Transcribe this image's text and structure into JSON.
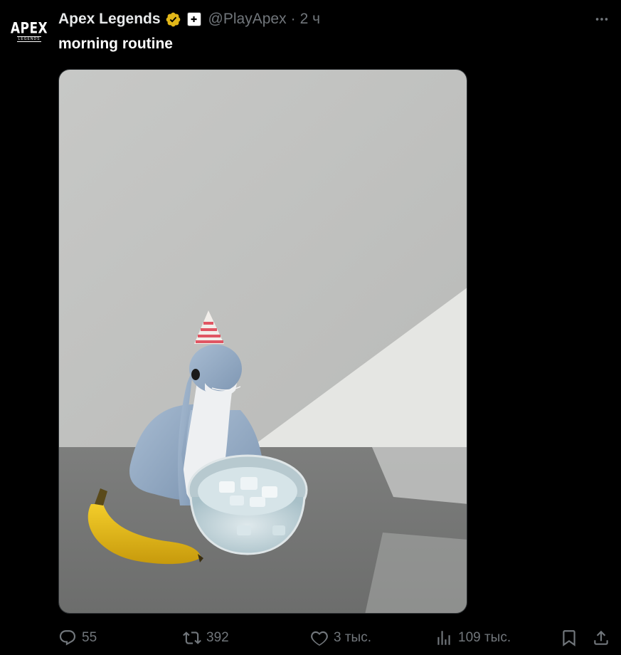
{
  "author": {
    "name": "Apex Legends",
    "handle": "@PlayApex",
    "separator": "·",
    "time": "2 ч",
    "avatar_text": "APEX",
    "avatar_subtext": "LEGENDS",
    "verified_icon": "gold-verified-badge-icon",
    "affiliate_icon": "affiliate-badge-icon"
  },
  "tweet": {
    "text": "morning routine"
  },
  "media": {
    "icon": "photo-plush-dinosaur-banana-ice-bowl"
  },
  "actions": {
    "replies": "55",
    "retweets": "392",
    "likes": "3 тыс.",
    "views": "109 тыс."
  },
  "colors": {
    "background": "#000000",
    "text_primary": "#e7e9ea",
    "text_secondary": "#71767b",
    "verified_gold": "#e2b719"
  }
}
